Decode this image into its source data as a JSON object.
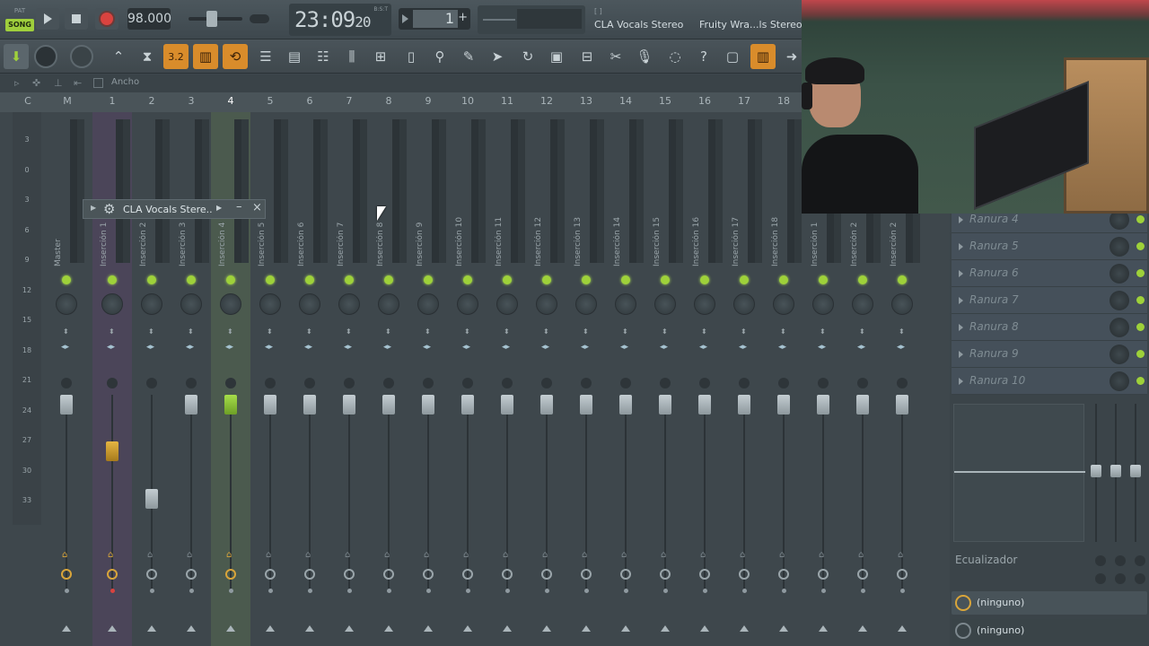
{
  "transport": {
    "pat_label": "PAT",
    "song_label": "SONG",
    "tempo": "98.000",
    "time": "23:09",
    "time_sub": "20",
    "time_unit": "B:S:T",
    "pattern_number": "1",
    "plus": "+"
  },
  "hint_bar": {
    "bracket": "[ ]",
    "title": "CLA Vocals Stereo",
    "title2": "Fruity Wra...ls Stereo"
  },
  "mixer_header": {
    "ancho_label": "Ancho"
  },
  "track_numbers": [
    "C",
    "M",
    "1",
    "2",
    "3",
    "4",
    "5",
    "6",
    "7",
    "8",
    "9",
    "10",
    "11",
    "12",
    "13",
    "14",
    "15",
    "16",
    "17",
    "18"
  ],
  "db_scale": [
    "3",
    "0",
    "3",
    "6",
    "9",
    "12",
    "15",
    "18",
    "21",
    "24",
    "27",
    "30",
    "33"
  ],
  "strips": [
    {
      "name": "Master"
    },
    {
      "name": "Inserción 1"
    },
    {
      "name": "Inserción 2"
    },
    {
      "name": "Inserción 3"
    },
    {
      "name": "Inserción 4"
    },
    {
      "name": "Inserción 5"
    },
    {
      "name": "Inserción 6"
    },
    {
      "name": "Inserción 7"
    },
    {
      "name": "Inserción 8"
    },
    {
      "name": "Inserción 9"
    },
    {
      "name": "Inserción 10"
    },
    {
      "name": "Inserción 11"
    },
    {
      "name": "Inserción 12"
    },
    {
      "name": "Inserción 13"
    },
    {
      "name": "Inserción 14"
    },
    {
      "name": "Inserción 15"
    },
    {
      "name": "Inserción 16"
    },
    {
      "name": "Inserción 17"
    },
    {
      "name": "Inserción 18"
    },
    {
      "name": "Inserción 1"
    },
    {
      "name": "Inserción 2"
    },
    {
      "name": "Inserción 2"
    }
  ],
  "plugin_bar": {
    "name": "CLA Vocals Stere..",
    "minimize": "–",
    "close": "×"
  },
  "slots": [
    "Ranura 4",
    "Ranura 5",
    "Ranura 6",
    "Ranura 7",
    "Ranura 8",
    "Ranura 9",
    "Ranura 10"
  ],
  "equalizer_label": "Ecualizador",
  "routing": {
    "input": "(ninguno)",
    "output": "(ninguno)"
  },
  "colors": {
    "accent_green": "#9ed13a",
    "accent_orange": "#d98c2b",
    "record_red": "#d9433f"
  }
}
